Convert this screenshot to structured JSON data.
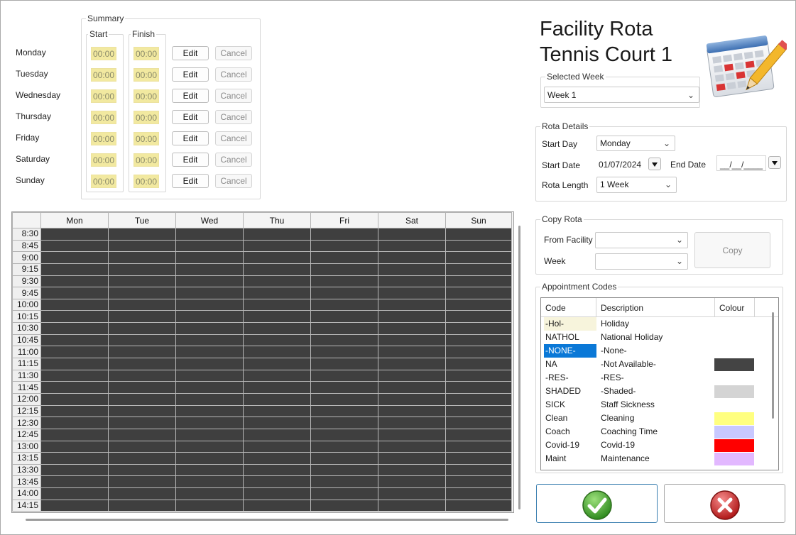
{
  "summary": {
    "legend": "Summary",
    "start_legend": "Start",
    "finish_legend": "Finish",
    "days": [
      {
        "day": "Monday",
        "start": "00:00",
        "finish": "00:00",
        "edit": "Edit",
        "cancel": "Cancel"
      },
      {
        "day": "Tuesday",
        "start": "00:00",
        "finish": "00:00",
        "edit": "Edit",
        "cancel": "Cancel"
      },
      {
        "day": "Wednesday",
        "start": "00:00",
        "finish": "00:00",
        "edit": "Edit",
        "cancel": "Cancel"
      },
      {
        "day": "Thursday",
        "start": "00:00",
        "finish": "00:00",
        "edit": "Edit",
        "cancel": "Cancel"
      },
      {
        "day": "Friday",
        "start": "00:00",
        "finish": "00:00",
        "edit": "Edit",
        "cancel": "Cancel"
      },
      {
        "day": "Saturday",
        "start": "00:00",
        "finish": "00:00",
        "edit": "Edit",
        "cancel": "Cancel"
      },
      {
        "day": "Sunday",
        "start": "00:00",
        "finish": "00:00",
        "edit": "Edit",
        "cancel": "Cancel"
      }
    ]
  },
  "header": {
    "title_line1": "Facility Rota",
    "title_line2": "Tennis Court 1"
  },
  "selected_week": {
    "legend": "Selected Week",
    "value": "Week 1"
  },
  "rota_details": {
    "legend": "Rota Details",
    "start_day_label": "Start Day",
    "start_day_value": "Monday",
    "start_date_label": "Start Date",
    "start_date_value": "01/07/2024",
    "end_date_label": "End Date",
    "end_date_value": "__/__/____",
    "rota_length_label": "Rota Length",
    "rota_length_value": "1 Week"
  },
  "copy_rota": {
    "legend": "Copy Rota",
    "from_facility_label": "From Facility",
    "week_label": "Week",
    "copy_button": "Copy"
  },
  "appointment_codes": {
    "legend": "Appointment Codes",
    "headers": {
      "code": "Code",
      "description": "Description",
      "colour": "Colour"
    },
    "rows": [
      {
        "code": "-Hol-",
        "description": "Holiday",
        "colour": "",
        "code_bg": "#f7f4dc",
        "selected": false
      },
      {
        "code": "NATHOL",
        "description": "National Holiday",
        "colour": "",
        "code_bg": "",
        "selected": false
      },
      {
        "code": "-NONE-",
        "description": "-None-",
        "colour": "",
        "code_bg": "#0a78d7",
        "selected": true
      },
      {
        "code": "NA",
        "description": "-Not Available-",
        "colour": "#444444",
        "code_bg": "",
        "selected": false
      },
      {
        "code": "-RES-",
        "description": "-RES-",
        "colour": "",
        "code_bg": "",
        "selected": false
      },
      {
        "code": "SHADED",
        "description": "-Shaded-",
        "colour": "#d4d4d4",
        "code_bg": "",
        "selected": false
      },
      {
        "code": "SICK",
        "description": "Staff Sickness",
        "colour": "",
        "code_bg": "",
        "selected": false
      },
      {
        "code": "Clean",
        "description": "Cleaning",
        "colour": "#ffff80",
        "code_bg": "",
        "selected": false
      },
      {
        "code": "Coach",
        "description": "Coaching Time",
        "colour": "#c8c8ff",
        "code_bg": "",
        "selected": false
      },
      {
        "code": "Covid-19",
        "description": "Covid-19",
        "colour": "#ff0000",
        "code_bg": "",
        "selected": false
      },
      {
        "code": "Maint",
        "description": "Maintenance",
        "colour": "#e2b8ff",
        "code_bg": "",
        "selected": false
      }
    ]
  },
  "rota_grid": {
    "columns": [
      "Mon",
      "Tue",
      "Wed",
      "Thu",
      "Fri",
      "Sat",
      "Sun"
    ],
    "times": [
      "8:30",
      "8:45",
      "9:00",
      "9:15",
      "9:30",
      "9:45",
      "10:00",
      "10:15",
      "10:30",
      "10:45",
      "11:00",
      "11:15",
      "11:30",
      "11:45",
      "12:00",
      "12:15",
      "12:30",
      "12:45",
      "13:00",
      "13:15",
      "13:30",
      "13:45",
      "14:00",
      "14:15"
    ]
  },
  "colors": {
    "time_highlight": "#f2e9a0",
    "grid_cell": "#3f3f3f",
    "selected_blue": "#0a78d7"
  },
  "icons": {
    "calendar": "calendar-pencil-icon",
    "ok": "check-icon",
    "cancel": "close-icon"
  }
}
